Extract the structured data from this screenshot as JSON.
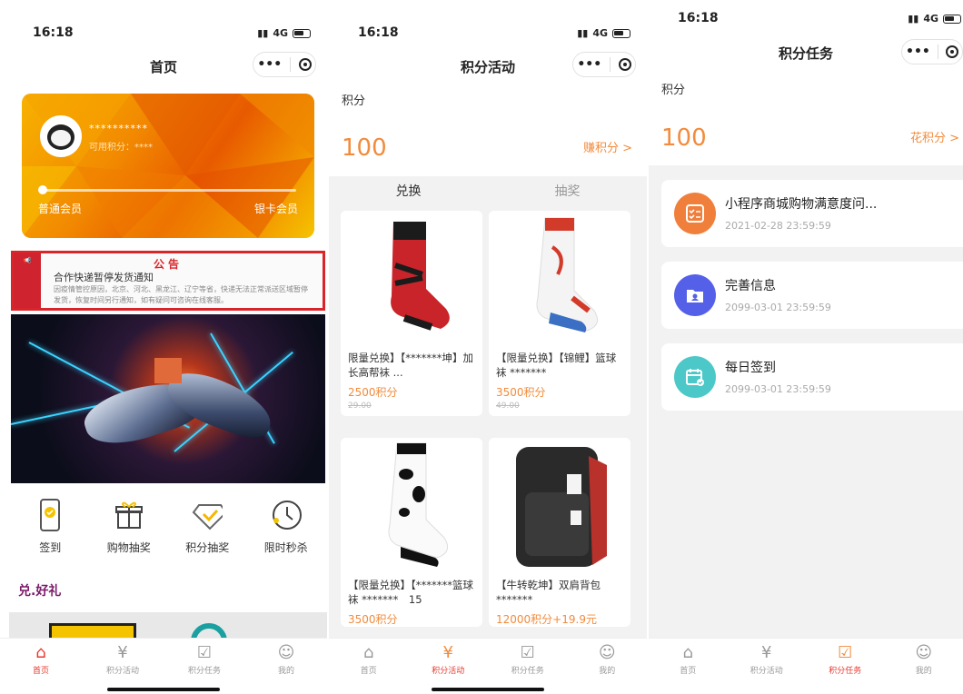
{
  "status": {
    "time": "16:18",
    "network": "4G"
  },
  "screen1": {
    "title": "首页",
    "card": {
      "username": "**********",
      "points_label": "可用积分：****",
      "level_left": "普通会员",
      "level_right": "银卡会员"
    },
    "notice": {
      "title": "公告",
      "headline": "合作快递暂停发货通知",
      "body": "因疫情管控原因，北京、河北、黑龙江、辽宁等省，快递无法正常派送区域暂停发货，恢复时间另行通知，如有疑问可咨询在线客服。"
    },
    "quick_entries": [
      {
        "label": "签到",
        "icon": "phone-check-icon"
      },
      {
        "label": "购物抽奖",
        "icon": "gift-icon"
      },
      {
        "label": "积分抽奖",
        "icon": "diamond-icon"
      },
      {
        "label": "限时秒杀",
        "icon": "clock-icon"
      }
    ],
    "section_title": "兑.好礼"
  },
  "screen2": {
    "title": "积分活动",
    "points_label": "积分",
    "points_value": "100",
    "earn_link": "赚积分 >",
    "tabs": [
      "兑换",
      "抽奖"
    ],
    "products": [
      {
        "name": "限量兑换】【*******坤】加长高帮袜 ...",
        "price": "2500积分",
        "original": "29.00",
        "image": "red-sock"
      },
      {
        "name": "【限量兑换】【锦鲤】篮球袜 *******",
        "price": "3500积分",
        "original": "49.00",
        "image": "white-sock"
      },
      {
        "name": "【限量兑换】【*******篮球袜 *******　15",
        "price": "3500积分",
        "original": "",
        "image": "cow-sock"
      },
      {
        "name": "【牛转乾坤】双肩背包 *******",
        "price": "12000积分+19.9元",
        "original": "",
        "image": "backpack"
      }
    ]
  },
  "screen3": {
    "title": "积分任务",
    "points_label": "积分",
    "points_value": "100",
    "spend_link": "花积分 >",
    "tasks": [
      {
        "name": "小程序商城购物满意度问...",
        "date": "2021-02-28 23:59:59",
        "icon": "survey-icon",
        "color": "#f07f3c"
      },
      {
        "name": "完善信息",
        "date": "2099-03-01 23:59:59",
        "icon": "profile-folder-icon",
        "color": "#5460e8"
      },
      {
        "name": "每日签到",
        "date": "2099-03-01 23:59:59",
        "icon": "calendar-check-icon",
        "color": "#4cc8c8"
      }
    ]
  },
  "tabbar": [
    "首页",
    "积分活动",
    "积分任务",
    "我的"
  ],
  "colors": {
    "accent": "#f28b3c",
    "active_tab": "#e7392e",
    "notice_red": "#d9252a"
  }
}
